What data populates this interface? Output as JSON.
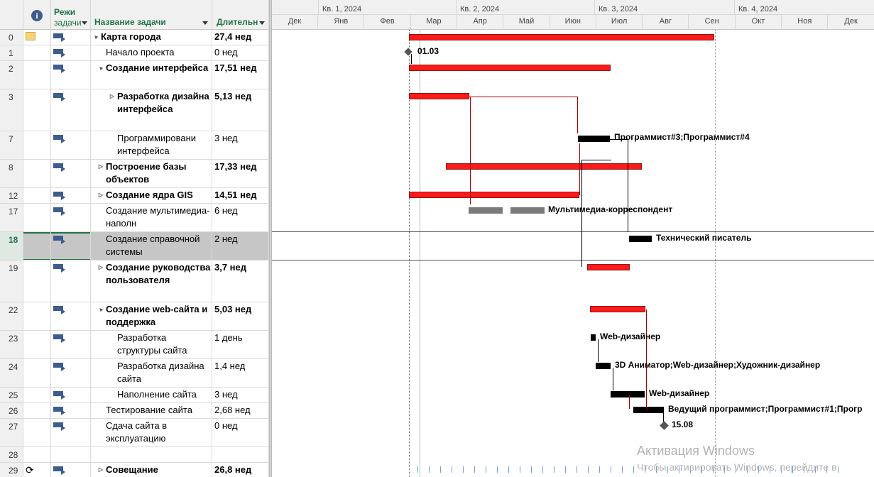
{
  "columns": {
    "info_icon": "info-icon",
    "mode_line1": "Режи",
    "mode_line2": "задачи",
    "name": "Название задачи",
    "duration": "Длительн"
  },
  "rows": [
    {
      "id": "0",
      "name": "Карта города",
      "duration": "27,4 нед",
      "bold": true,
      "toggle": "▲"
    },
    {
      "id": "1",
      "name": "Начало проекта",
      "duration": "0 нед",
      "bold": false
    },
    {
      "id": "2",
      "name": "Создание интерфейса",
      "duration": "17,51 нед",
      "bold": true,
      "toggle": "▲"
    },
    {
      "id": "3",
      "name": "Разработка дизайна интерфейса",
      "duration": "5,13 нед",
      "bold": true,
      "toggle": "▷"
    },
    {
      "id": "7",
      "name": "Программировани интерфейса",
      "duration": "3 нед",
      "bold": false
    },
    {
      "id": "8",
      "name": "Построение базы объектов",
      "duration": "17,33 нед",
      "bold": true,
      "toggle": "▷"
    },
    {
      "id": "12",
      "name": "Создание ядра GIS",
      "duration": "14,51 нед",
      "bold": true,
      "toggle": "▷"
    },
    {
      "id": "17",
      "name": "Создание мультимедиа-наполн",
      "duration": "6 нед",
      "bold": false
    },
    {
      "id": "18",
      "name": "Создание справочной системы",
      "duration": "2 нед",
      "bold": false
    },
    {
      "id": "19",
      "name": "Создание руководства пользователя",
      "duration": "3,7 нед",
      "bold": true,
      "toggle": "▷"
    },
    {
      "id": "22",
      "name": "Создание web-сайта и поддержка",
      "duration": "5,03 нед",
      "bold": true,
      "toggle": "▲"
    },
    {
      "id": "23",
      "name": "Разработка структуры сайта",
      "duration": "1 день",
      "bold": false
    },
    {
      "id": "24",
      "name": "Разработка дизайна сайта",
      "duration": "1,4 нед",
      "bold": false
    },
    {
      "id": "25",
      "name": "Наполнение сайта",
      "duration": "3 нед",
      "bold": false
    },
    {
      "id": "26",
      "name": "Тестирование сайта",
      "duration": "2,68 нед",
      "bold": false
    },
    {
      "id": "27",
      "name": "Сдача сайта в эксплуатацию",
      "duration": "0 нед",
      "bold": false
    },
    {
      "id": "28",
      "name": "",
      "duration": "",
      "bold": false
    },
    {
      "id": "29",
      "name": "Совещание",
      "duration": "26,8 нед",
      "bold": true,
      "toggle": "▷"
    }
  ],
  "timescale": {
    "quarters": [
      "Кв. 1, 2024",
      "Кв. 2, 2024",
      "Кв. 3, 2024",
      "Кв. 4, 2024"
    ],
    "months": [
      "Дек",
      "Янв",
      "Фев",
      "Мар",
      "Апр",
      "Май",
      "Июн",
      "Июл",
      "Авг",
      "Сен",
      "Окт",
      "Ноя",
      "Дек"
    ]
  },
  "chart_labels": {
    "milestone_start": "01.03",
    "r7": "Программист#3;Программист#4",
    "r17": "Мультимедиа-корреспондент",
    "r18": "Технический писатель",
    "r23": "Web-дизайнер",
    "r24": "3D Аниматор;Web-дизайнер;Художник-дизайнер",
    "r25": "Web-дизайнер",
    "r26": "Ведущий программист;Программист#1;Прогр",
    "milestone_end": "15.08"
  },
  "watermark": {
    "title": "Активация Windows",
    "subtitle": "Чтобы активировать Windows, перейдите в"
  },
  "colors": {
    "header_green": "#217346",
    "critical_bar": "#ff1a1a",
    "selected_row": "#c6c6c6"
  }
}
